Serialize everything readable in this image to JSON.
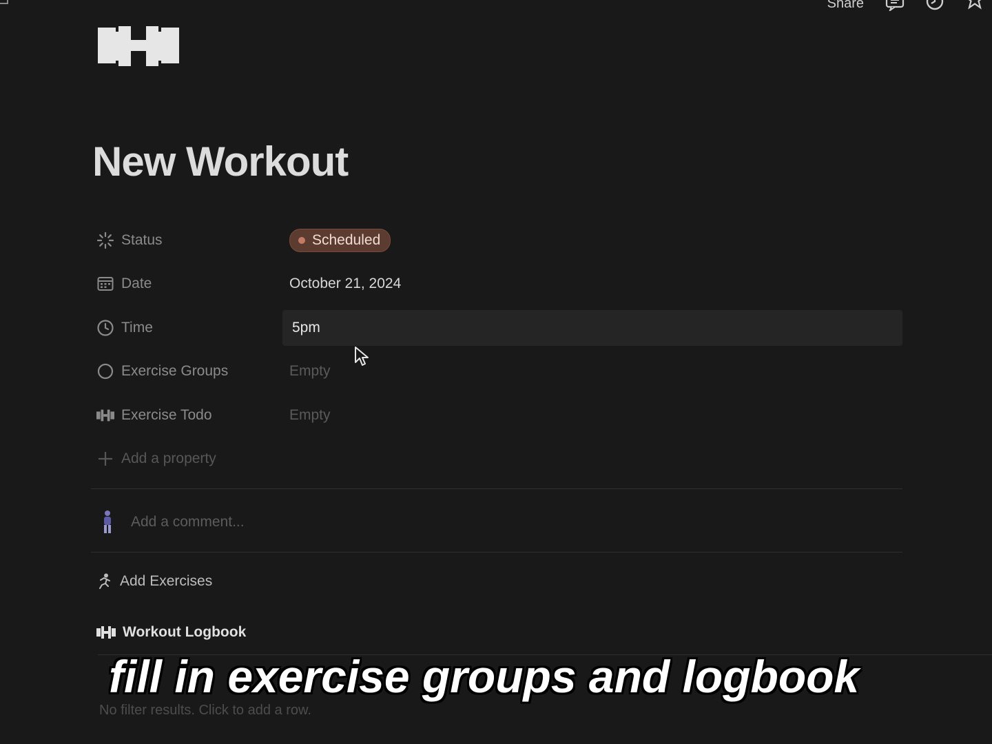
{
  "topbar": {
    "share_label": "Share"
  },
  "page": {
    "title": "New Workout"
  },
  "properties": [
    {
      "label": "Status",
      "value": "Scheduled",
      "icon": "status-spinner-icon"
    },
    {
      "label": "Date",
      "value": "October 21, 2024",
      "icon": "calendar-icon"
    },
    {
      "label": "Time",
      "value": "5pm",
      "icon": "clock-icon"
    },
    {
      "label": "Exercise Groups",
      "value": "Empty",
      "icon": "circle-icon"
    },
    {
      "label": "Exercise Todo",
      "value": "Empty",
      "icon": "dumbbell-icon"
    }
  ],
  "add_property_label": "Add a property",
  "comment": {
    "placeholder": "Add a comment..."
  },
  "add_exercises_label": "Add Exercises",
  "logbook": {
    "title": "Workout Logbook",
    "empty_text": "No filter results. Click to add a row."
  },
  "caption": "fill in exercise groups and logbook",
  "colors": {
    "background": "#191919",
    "status_pill": "#5c3b30",
    "status_dot": "#c27c63"
  }
}
